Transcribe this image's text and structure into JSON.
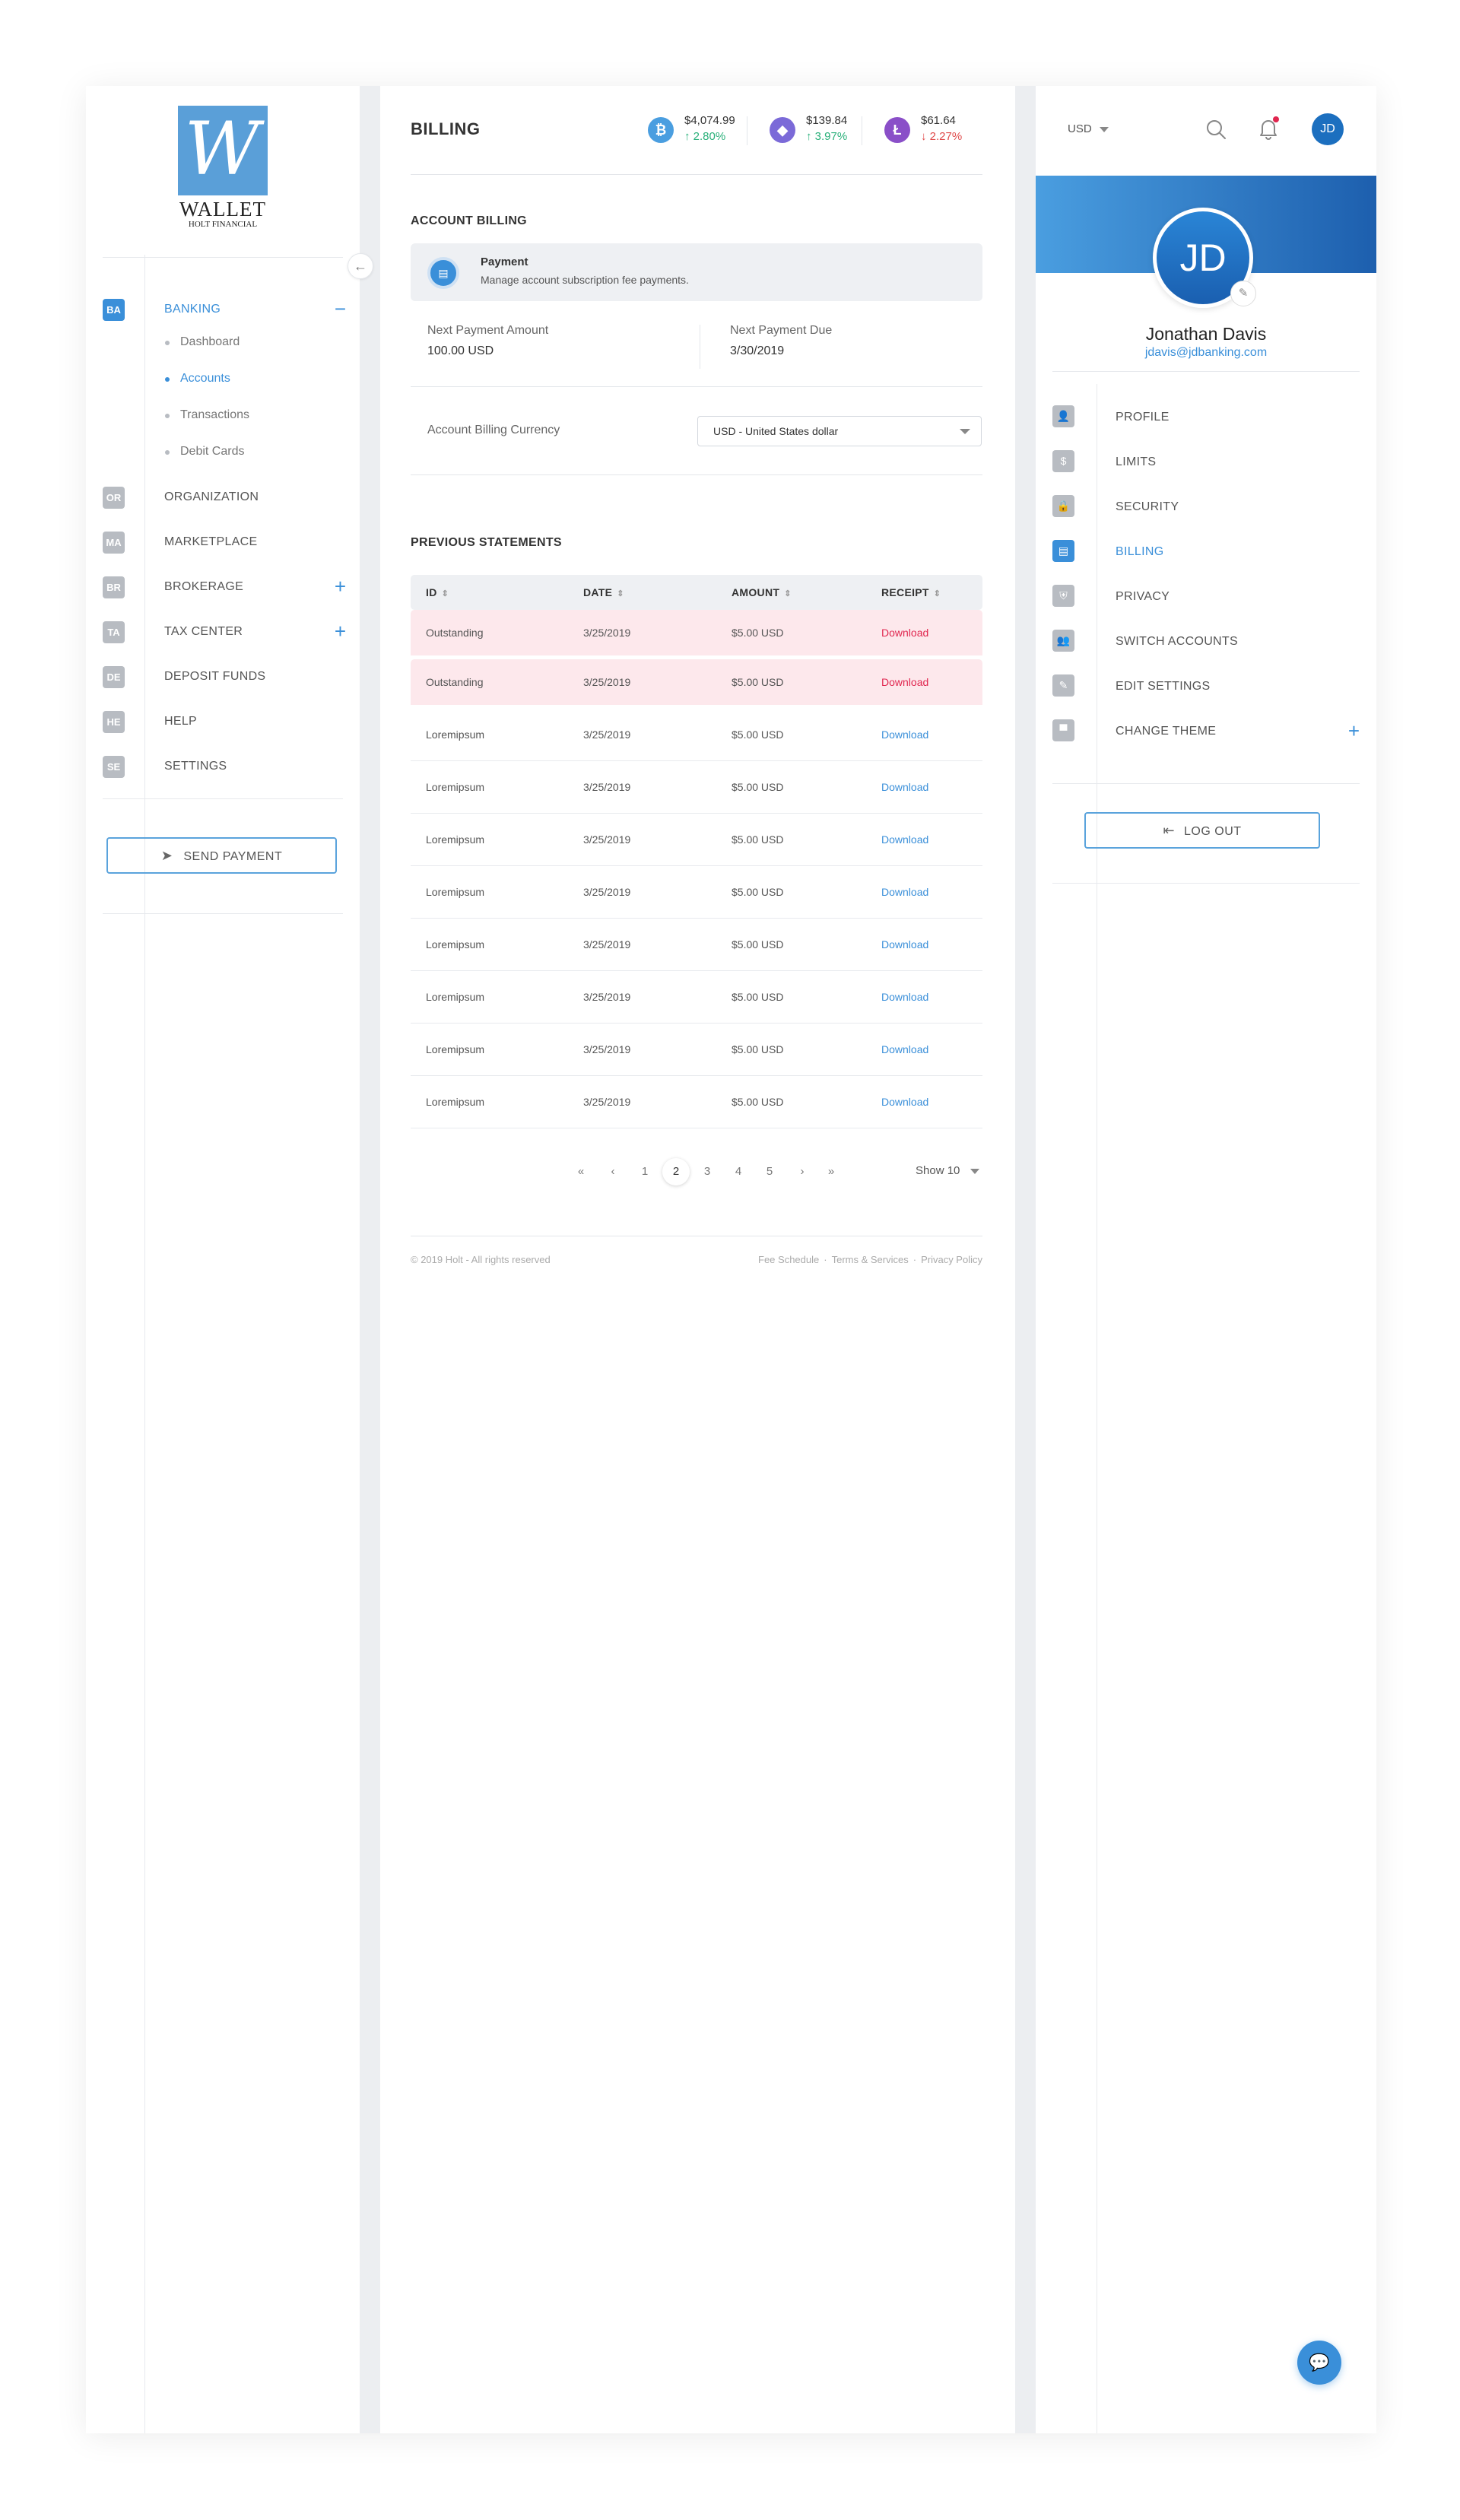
{
  "brand": {
    "logo_letter": "W",
    "name": "WALLET",
    "subtitle": "HOLT FINANCIAL"
  },
  "sidebar": {
    "items": [
      {
        "badge": "BA",
        "label": "BANKING",
        "toggle": "−",
        "active": true,
        "children": [
          {
            "label": "Dashboard"
          },
          {
            "label": "Accounts",
            "active": true
          },
          {
            "label": "Transactions"
          },
          {
            "label": "Debit Cards"
          }
        ]
      },
      {
        "badge": "OR",
        "label": "ORGANIZATION"
      },
      {
        "badge": "MA",
        "label": "MARKETPLACE"
      },
      {
        "badge": "BR",
        "label": "BROKERAGE",
        "toggle": "+"
      },
      {
        "badge": "TA",
        "label": "TAX CENTER",
        "toggle": "+"
      },
      {
        "badge": "DE",
        "label": "DEPOSIT FUNDS"
      },
      {
        "badge": "HE",
        "label": "HELP"
      },
      {
        "badge": "SE",
        "label": "SETTINGS"
      }
    ],
    "send_payment": "SEND PAYMENT"
  },
  "header": {
    "title": "BILLING",
    "tickers": [
      {
        "icon": "bitcoin-icon",
        "symbol": "₿",
        "color": "#4a9ee0",
        "price": "$4,074.99",
        "change": "2.80%",
        "direction": "up"
      },
      {
        "icon": "ethereum-icon",
        "symbol": "◆",
        "color": "#7b6ad8",
        "price": "$139.84",
        "change": "3.97%",
        "direction": "up"
      },
      {
        "icon": "litecoin-icon",
        "symbol": "Ł",
        "color": "#8a4fc8",
        "price": "$61.64",
        "change": "2.27%",
        "direction": "down"
      }
    ]
  },
  "account_billing": {
    "section_title": "ACCOUNT BILLING",
    "card_title": "Payment",
    "card_desc": "Manage account subscription fee payments.",
    "next_amount_label": "Next Payment Amount",
    "next_amount_value": "100.00 USD",
    "next_due_label": "Next Payment Due",
    "next_due_value": "3/30/2019",
    "currency_label": "Account Billing Currency",
    "currency_selected": "USD - United States dollar"
  },
  "statements": {
    "section_title": "PREVIOUS STATEMENTS",
    "columns": [
      "ID",
      "DATE",
      "AMOUNT",
      "RECEIPT"
    ],
    "rows": [
      {
        "id": "Outstanding",
        "date": "3/25/2019",
        "amount": "$5.00 USD",
        "receipt": "Download",
        "status": "outstanding"
      },
      {
        "id": "Outstanding",
        "date": "3/25/2019",
        "amount": "$5.00 USD",
        "receipt": "Download",
        "status": "outstanding"
      },
      {
        "id": "Loremipsum",
        "date": "3/25/2019",
        "amount": "$5.00 USD",
        "receipt": "Download",
        "status": "paid"
      },
      {
        "id": "Loremipsum",
        "date": "3/25/2019",
        "amount": "$5.00 USD",
        "receipt": "Download",
        "status": "paid"
      },
      {
        "id": "Loremipsum",
        "date": "3/25/2019",
        "amount": "$5.00 USD",
        "receipt": "Download",
        "status": "paid"
      },
      {
        "id": "Loremipsum",
        "date": "3/25/2019",
        "amount": "$5.00 USD",
        "receipt": "Download",
        "status": "paid"
      },
      {
        "id": "Loremipsum",
        "date": "3/25/2019",
        "amount": "$5.00 USD",
        "receipt": "Download",
        "status": "paid"
      },
      {
        "id": "Loremipsum",
        "date": "3/25/2019",
        "amount": "$5.00 USD",
        "receipt": "Download",
        "status": "paid"
      },
      {
        "id": "Loremipsum",
        "date": "3/25/2019",
        "amount": "$5.00 USD",
        "receipt": "Download",
        "status": "paid"
      },
      {
        "id": "Loremipsum",
        "date": "3/25/2019",
        "amount": "$5.00 USD",
        "receipt": "Download",
        "status": "paid"
      }
    ]
  },
  "pagination": {
    "first": "«",
    "prev": "‹",
    "next": "›",
    "last": "»",
    "pages": [
      "1",
      "2",
      "3",
      "4",
      "5"
    ],
    "current": "2",
    "show_label": "Show 10"
  },
  "footer": {
    "copyright": "© 2019 Holt - All rights reserved",
    "links": [
      "Fee Schedule",
      "Terms & Services",
      "Privacy Policy"
    ],
    "separator": "·"
  },
  "profile": {
    "currency": "USD",
    "initials": "JD",
    "name": "Jonathan Davis",
    "email": "jdavis@jdbanking.com",
    "menu": [
      {
        "icon": "user-icon",
        "glyph": "👤",
        "label": "PROFILE"
      },
      {
        "icon": "dollar-icon",
        "glyph": "$",
        "label": "LIMITS"
      },
      {
        "icon": "lock-icon",
        "glyph": "🔒",
        "label": "SECURITY"
      },
      {
        "icon": "billing-icon",
        "glyph": "▤",
        "label": "BILLING",
        "active": true
      },
      {
        "icon": "shield-icon",
        "glyph": "⛨",
        "label": "PRIVACY"
      },
      {
        "icon": "users-icon",
        "glyph": "👥",
        "label": "SWITCH ACCOUNTS"
      },
      {
        "icon": "edit-icon",
        "glyph": "✎",
        "label": "EDIT SETTINGS"
      },
      {
        "icon": "paint-roller-icon",
        "glyph": "▀",
        "label": "CHANGE THEME",
        "toggle": "+"
      }
    ],
    "logout": "LOG OUT"
  },
  "colors": {
    "accent": "#3a8fd9",
    "danger": "#e0264f",
    "success": "#2ab07a"
  }
}
